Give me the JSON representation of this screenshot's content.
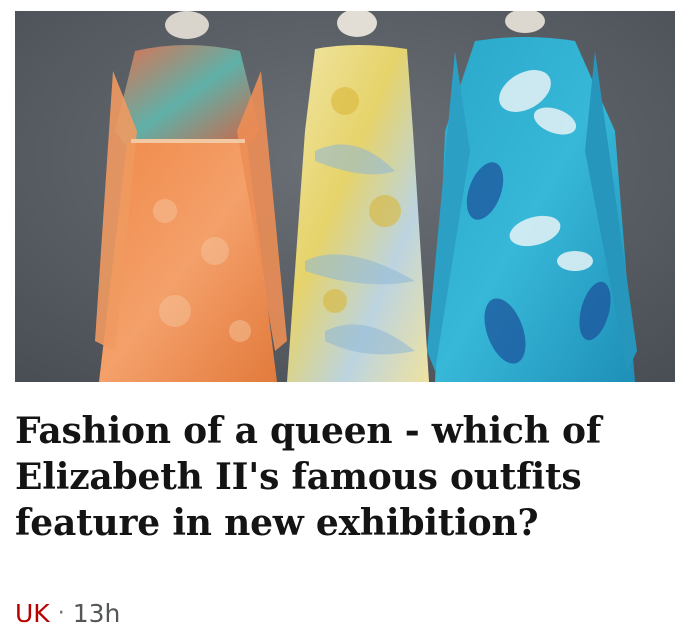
{
  "article": {
    "image_alt": "Three dresses on mannequins: an orange beaded gown, a pale yellow and blue print dress, and a turquoise floral dress",
    "headline": "Fashion of a queen - which of Elizabeth II's famous outfits feature in new exhibition?",
    "topic": "UK",
    "separator": "·",
    "time_ago": "13h"
  },
  "colors": {
    "accent": "#b80000",
    "headline": "#141414",
    "meta_text": "#545658",
    "image_background": "#5a5f66"
  }
}
